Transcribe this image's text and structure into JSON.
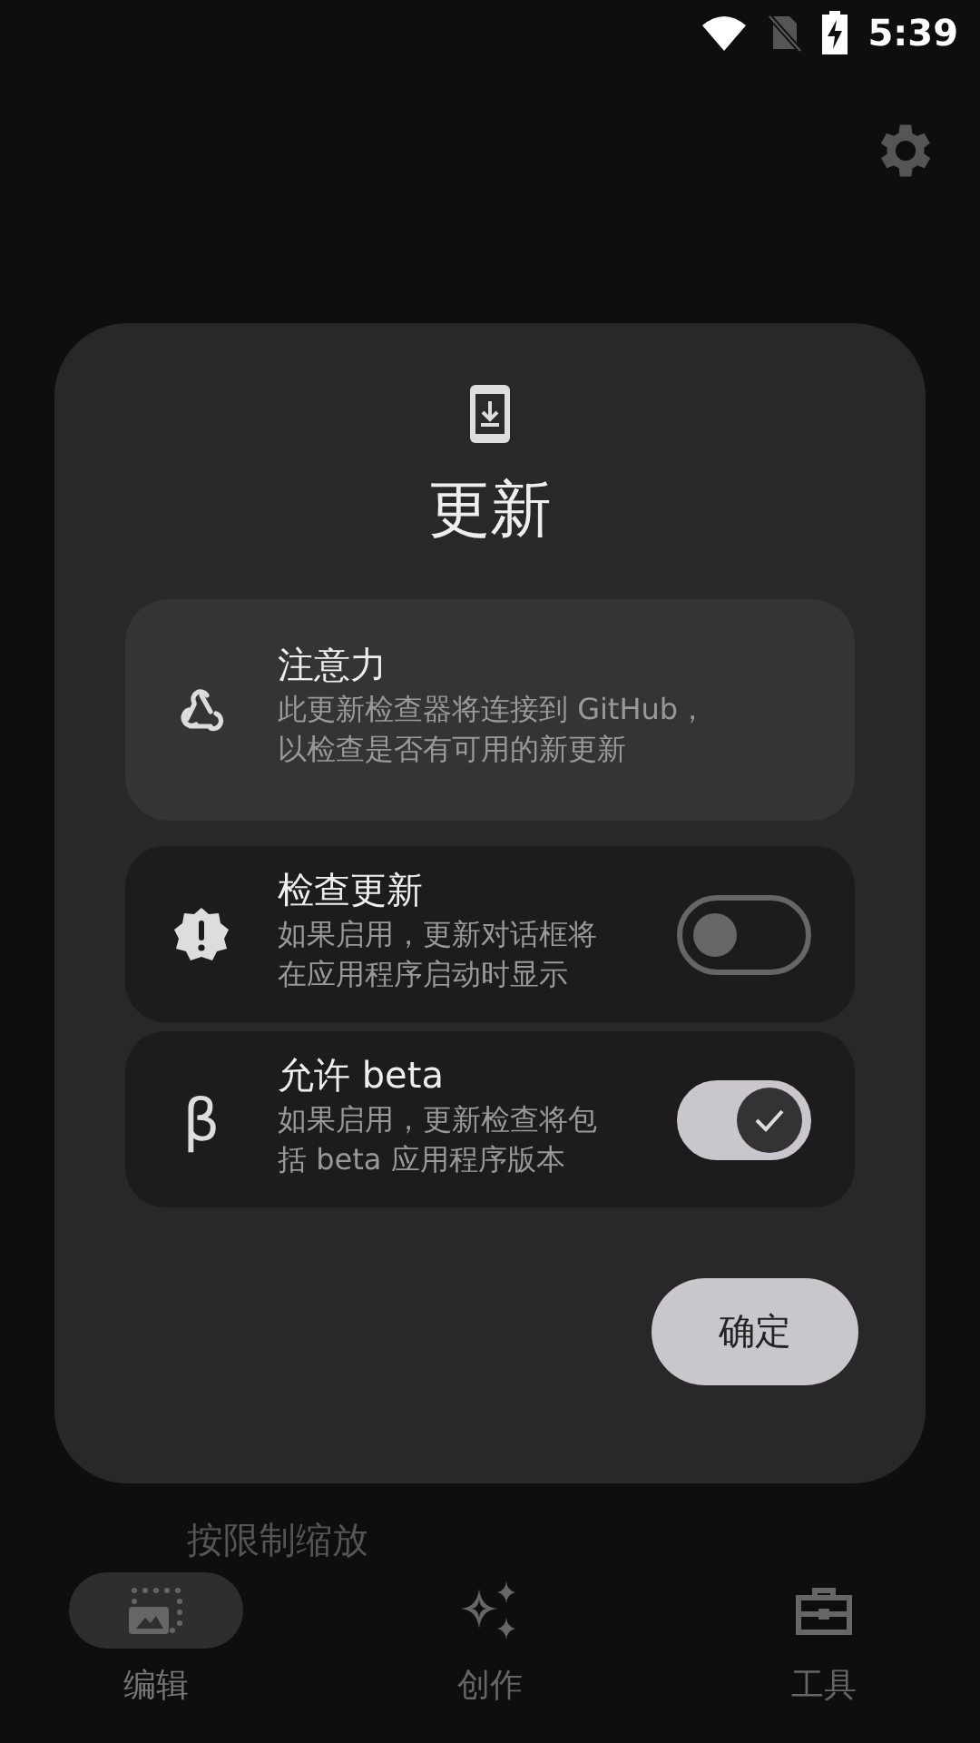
{
  "status_bar": {
    "time": "5:39"
  },
  "background": {
    "partial_text": "按限制缩放"
  },
  "dialog": {
    "title": "更新",
    "notice": {
      "title": "注意力",
      "text": "此更新检查器将连接到 GitHub，以检查是否有可用的新更新"
    },
    "settings": [
      {
        "kind": "alert",
        "title": "检查更新",
        "text": "如果启用，更新对话框将在应用程序启动时显示",
        "on": false
      },
      {
        "kind": "beta",
        "icon": "β",
        "title": "允许 beta",
        "text": "如果启用，更新检查将包括 beta 应用程序版本",
        "on": true
      }
    ],
    "confirm_button": "确定"
  },
  "nav": [
    {
      "kind": "edit",
      "label": "编辑",
      "selected": true
    },
    {
      "kind": "create",
      "label": "创作",
      "selected": false
    },
    {
      "kind": "tools",
      "label": "工具",
      "selected": false
    }
  ]
}
